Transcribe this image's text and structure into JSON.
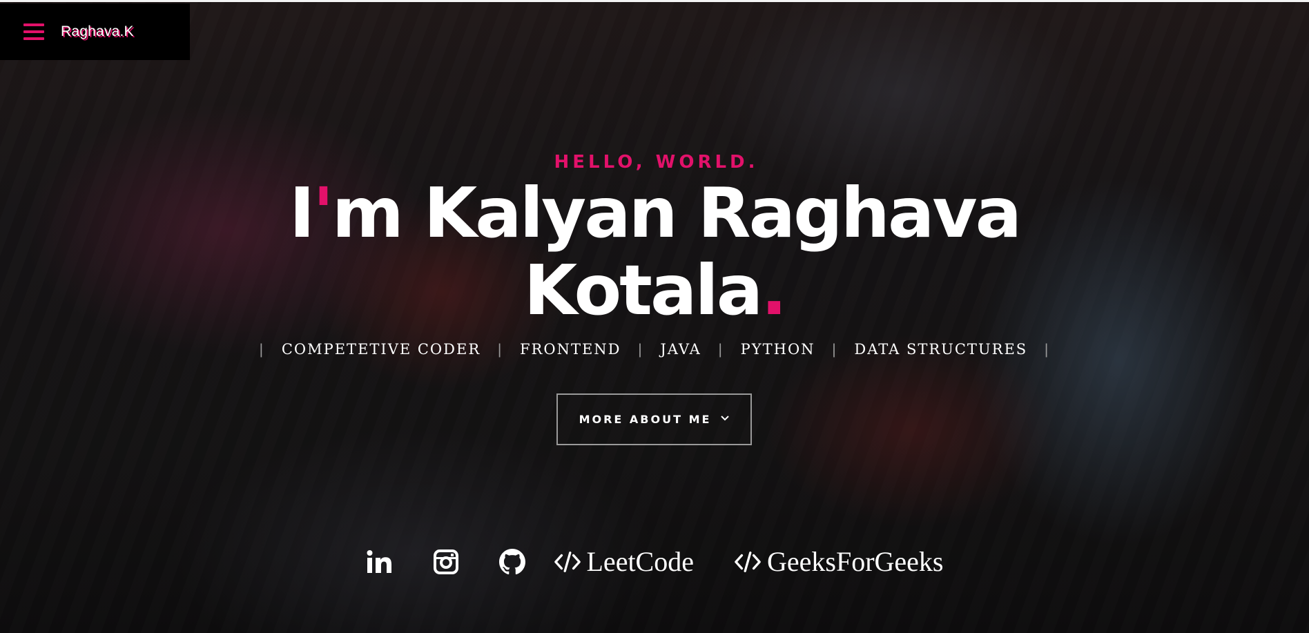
{
  "header": {
    "brand_name": "Raghava.K",
    "menu_icon": "hamburger-menu-icon"
  },
  "hero": {
    "greeting": "HELLO, WORLD.",
    "headline_prefix": "I",
    "headline_apostrophe": "'",
    "headline_line1_rest": "m Kalyan Raghava",
    "headline_line2": "Kotala",
    "headline_period": ".",
    "skills": [
      "COMPETETIVE CODER",
      "FRONTEND",
      "JAVA",
      "PYTHON",
      "DATA STRUCTURES"
    ],
    "separator": "|",
    "cta_label": "MORE ABOUT ME",
    "cta_icon": "chevron-down-icon"
  },
  "social": [
    {
      "icon": "linkedin-icon",
      "label": ""
    },
    {
      "icon": "instagram-icon",
      "label": ""
    },
    {
      "icon": "github-icon",
      "label": ""
    },
    {
      "icon": "code-icon",
      "label": "LeetCode"
    },
    {
      "icon": "code-icon",
      "label": "GeeksForGeeks"
    }
  ],
  "colors": {
    "accent": "#e2116a",
    "text": "#ffffff",
    "brand_bar": "#000000"
  }
}
